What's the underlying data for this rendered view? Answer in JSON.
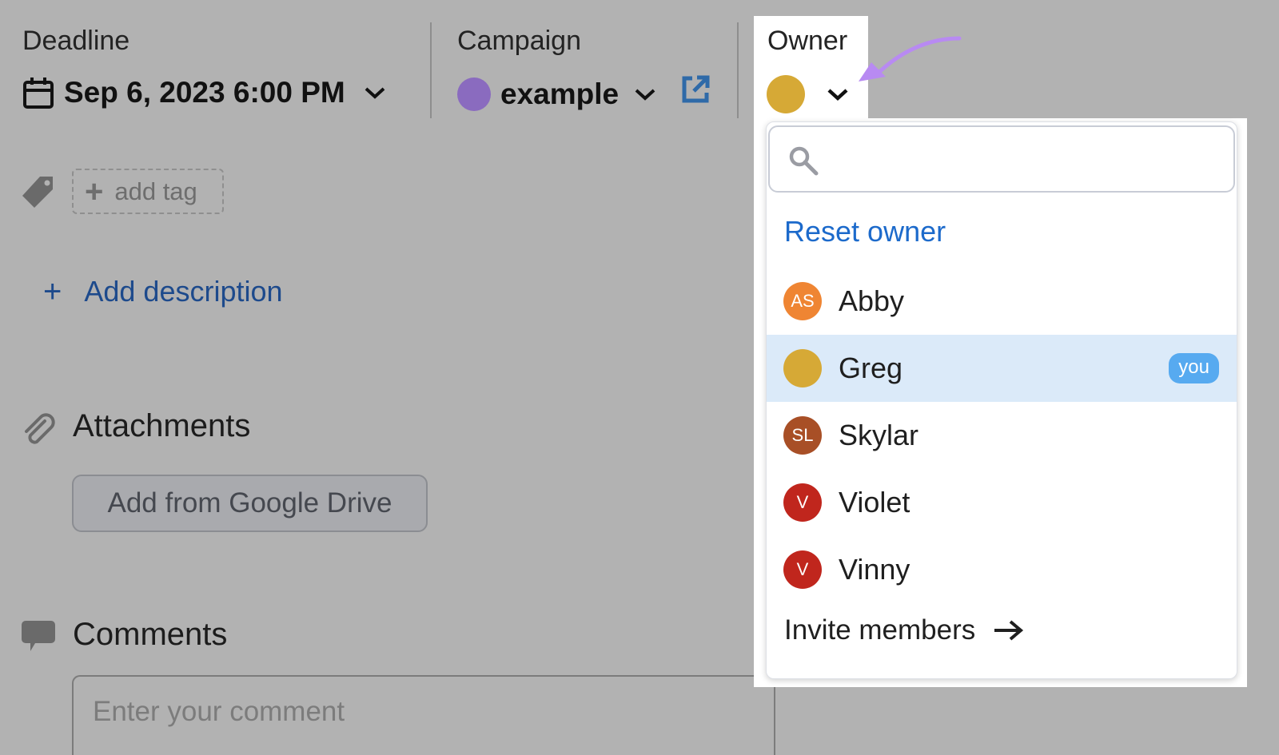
{
  "deadline": {
    "label": "Deadline",
    "value": "Sep 6, 2023 6:00 PM",
    "icon": "calendar-icon"
  },
  "campaign": {
    "label": "Campaign",
    "value": "example",
    "color": "#8a6bbf",
    "external_link_icon": "external-link-icon"
  },
  "owner": {
    "label": "Owner",
    "color": "#d6a936",
    "annotation_arrow_color": "#b88af2"
  },
  "tags": {
    "icon": "tag-icon",
    "add_tag_label": "add tag"
  },
  "description": {
    "add_label": "Add description"
  },
  "attachments": {
    "title": "Attachments",
    "google_drive_button": "Add from Google Drive"
  },
  "comments": {
    "title": "Comments",
    "placeholder": "Enter your comment"
  },
  "owner_dropdown": {
    "search_placeholder": "",
    "reset_label": "Reset owner",
    "members": [
      {
        "name": "Abby",
        "initials": "AS",
        "color": "#ef8533",
        "selected": false
      },
      {
        "name": "Greg",
        "initials": "",
        "color": "#d6a936",
        "selected": true,
        "badge": "you"
      },
      {
        "name": "Skylar",
        "initials": "SL",
        "color": "#a84f26",
        "selected": false
      },
      {
        "name": "Violet",
        "initials": "V",
        "color": "#c0261d",
        "selected": false
      },
      {
        "name": "Vinny",
        "initials": "V",
        "color": "#c0261d",
        "selected": false
      }
    ],
    "invite_label": "Invite members"
  }
}
